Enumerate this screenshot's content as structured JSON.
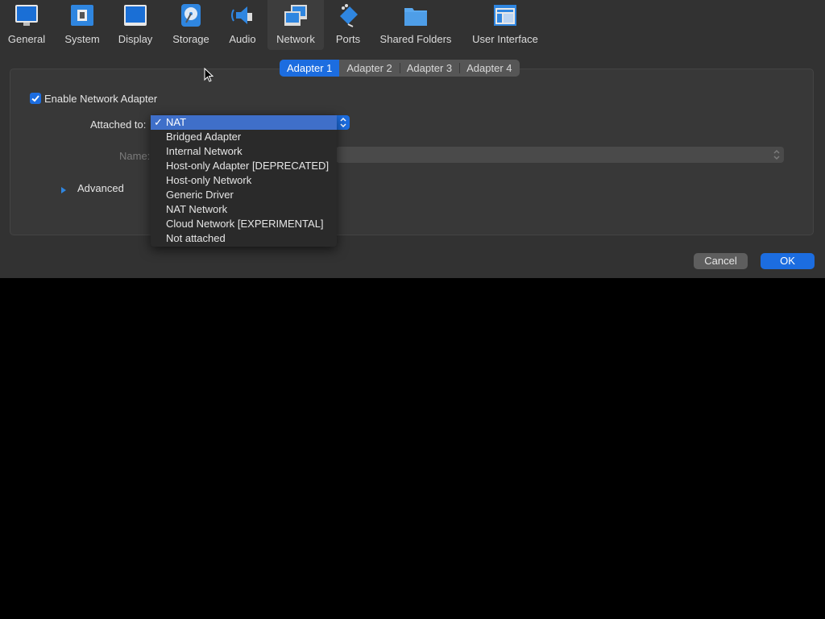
{
  "toolbar": {
    "items": [
      {
        "label": "General",
        "icon": "general-icon"
      },
      {
        "label": "System",
        "icon": "system-icon"
      },
      {
        "label": "Display",
        "icon": "display-icon"
      },
      {
        "label": "Storage",
        "icon": "storage-icon"
      },
      {
        "label": "Audio",
        "icon": "audio-icon"
      },
      {
        "label": "Network",
        "icon": "network-icon",
        "selected": true
      },
      {
        "label": "Ports",
        "icon": "ports-icon"
      },
      {
        "label": "Shared Folders",
        "icon": "folder-icon"
      },
      {
        "label": "User Interface",
        "icon": "user-interface-icon"
      }
    ]
  },
  "tabs": [
    {
      "label": "Adapter 1",
      "active": true
    },
    {
      "label": "Adapter 2"
    },
    {
      "label": "Adapter 3"
    },
    {
      "label": "Adapter 4"
    }
  ],
  "form": {
    "enable_label": "Enable Network Adapter",
    "enable_checked": true,
    "attached_label": "Attached to:",
    "name_label": "Name:",
    "advanced_label": "Advanced"
  },
  "dropdown": {
    "selected": "NAT",
    "check_glyph": "✓",
    "options": [
      "NAT",
      "Bridged Adapter",
      "Internal Network",
      "Host-only Adapter [DEPRECATED]",
      "Host-only Network",
      "Generic Driver",
      "NAT Network",
      "Cloud Network [EXPERIMENTAL]",
      "Not attached"
    ]
  },
  "buttons": {
    "cancel": "Cancel",
    "ok": "OK"
  },
  "colors": {
    "accent": "#1c6de0",
    "window_bg": "#323232",
    "menu_highlight": "#3f6fc9"
  }
}
